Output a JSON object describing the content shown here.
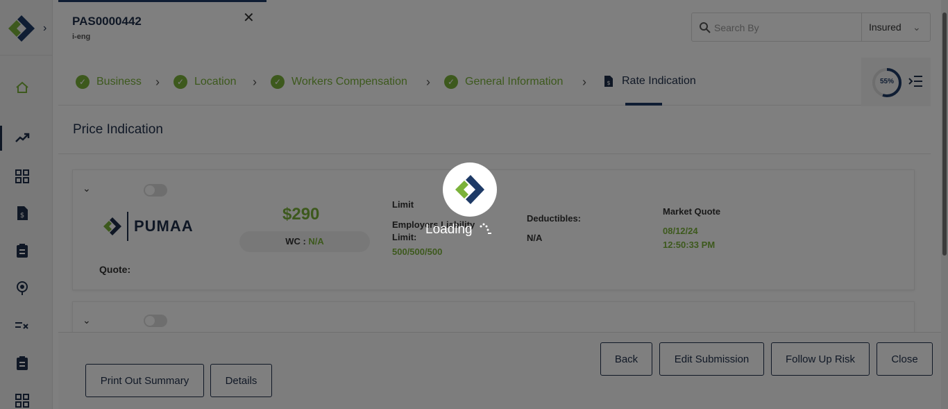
{
  "policy": {
    "number": "PAS0000442",
    "sub": "i-eng"
  },
  "search": {
    "placeholder": "Search By",
    "filter": "Insured"
  },
  "stepper": {
    "steps": [
      {
        "label": "Business",
        "status": "complete"
      },
      {
        "label": "Location",
        "status": "complete"
      },
      {
        "label": "Workers Compensation",
        "status": "complete"
      },
      {
        "label": "General Information",
        "status": "complete"
      },
      {
        "label": "Rate Indication",
        "status": "current"
      }
    ],
    "progress_label": "55%",
    "progress_value": 55
  },
  "section_title": "Price Indication",
  "quote": {
    "carrier": "PUMAA",
    "quote_label": "Quote:",
    "price": "$290",
    "wc_label": "WC :",
    "wc_value": "N/A",
    "limit_label": "Limit",
    "limit_sub": "Employers Liability Limit:",
    "limit_value": "500/500/500",
    "deductibles_label": "Deductibles:",
    "deductibles_value": "N/A",
    "market_quote_label": "Market Quote",
    "market_quote_date": "08/12/24",
    "market_quote_time": "12:50:33 PM"
  },
  "buttons": {
    "print_summary": "Print Out Summary",
    "details": "Details",
    "back": "Back",
    "edit_submission": "Edit Submission",
    "follow_up": "Follow Up Risk",
    "close": "Close"
  },
  "loading": {
    "text": "Loading"
  },
  "colors": {
    "brand_navy": "#1e3a66",
    "brand_green": "#7bb23a",
    "overlay": "rgba(0,0,0,0.5)"
  },
  "icons": {
    "sidebar": [
      "home-icon",
      "trending-up-icon",
      "grid-icon",
      "invoice-icon",
      "clipboard-icon",
      "location-icon",
      "checklist-icon",
      "clipboard-icon",
      "grid-icon"
    ]
  }
}
